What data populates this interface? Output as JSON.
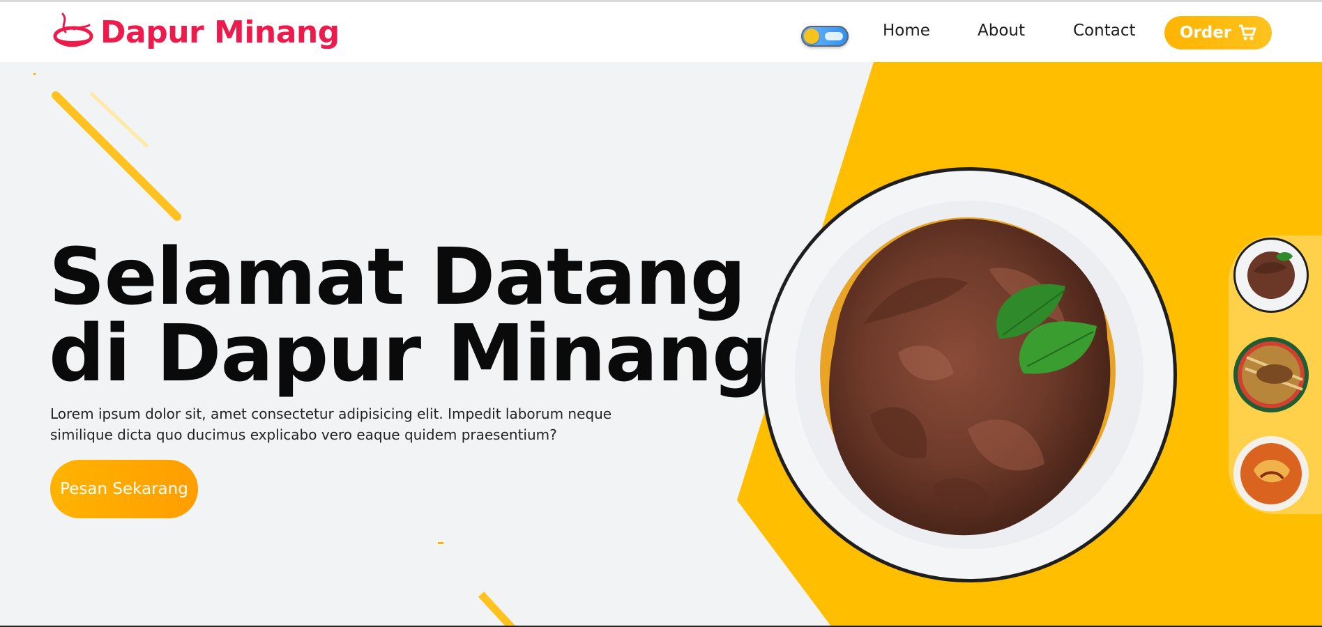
{
  "brand": {
    "name": "Dapur Minang",
    "logo_icon": "bowl-steam-logo-icon",
    "color": "#ee1a4c"
  },
  "header": {
    "theme_toggle": {
      "state": "light"
    },
    "nav": [
      {
        "label": "Home"
      },
      {
        "label": "About"
      },
      {
        "label": "Contact"
      }
    ],
    "order_button": {
      "label": "Order",
      "icon": "cart-icon"
    }
  },
  "hero": {
    "title_line_1": "Selamat Datang",
    "title_line_2": "di Dapur Minang",
    "description": "Lorem ipsum dolor sit, amet consectetur adipisicing elit. Impedit laborum neque similique dicta quo ducimus explicabo vero eaque quidem praesentium?",
    "cta_label": "Pesan Sekarang",
    "main_image": "rendang-plate-image"
  },
  "thumbnails": [
    {
      "image": "rendang-thumbnail",
      "selected": true
    },
    {
      "image": "sate-thumbnail",
      "selected": false
    },
    {
      "image": "gulai-thumbnail",
      "selected": false
    }
  ],
  "colors": {
    "accent": "#ffbf00",
    "brand": "#ee1a4c",
    "background": "#f2f3f5",
    "text": "#0a0a0a"
  }
}
